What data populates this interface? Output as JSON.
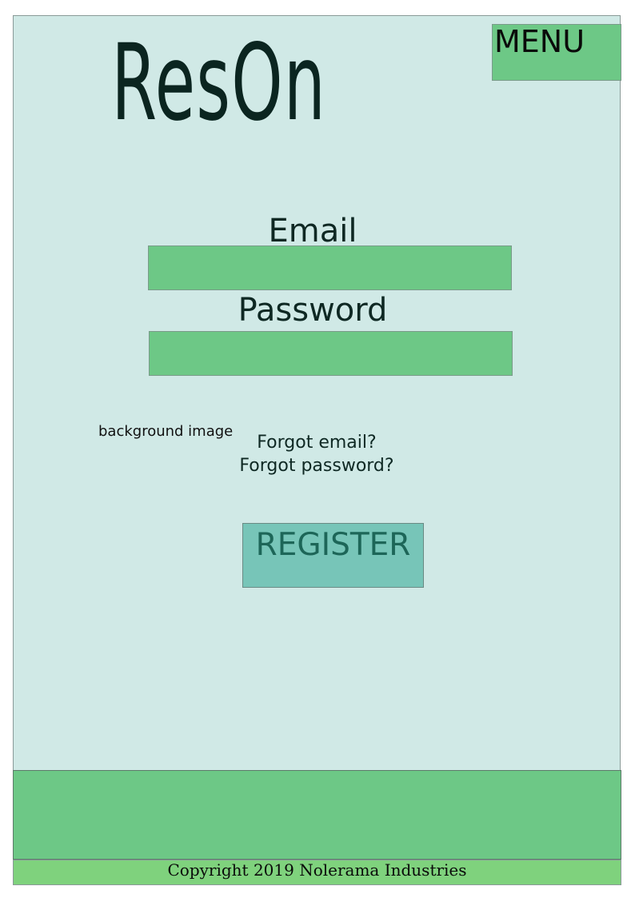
{
  "header": {
    "logo_text": "ResOn",
    "menu_label": "MENU"
  },
  "login": {
    "email_label": "Email",
    "email_value": "",
    "password_label": "Password",
    "password_value": "",
    "forgot_email": "Forgot email?",
    "forgot_password": "Forgot password?",
    "register_label": "REGISTER"
  },
  "background": {
    "placeholder_text": "background image"
  },
  "footer": {
    "copyright": "Copyright 2019 Nolerama Industries"
  },
  "colors": {
    "page_background": "#d0e9e6",
    "field_green": "#6dc886",
    "register_teal": "#77c5b8",
    "copyright_green": "#7fd27d",
    "text_dark": "#0e2823"
  }
}
